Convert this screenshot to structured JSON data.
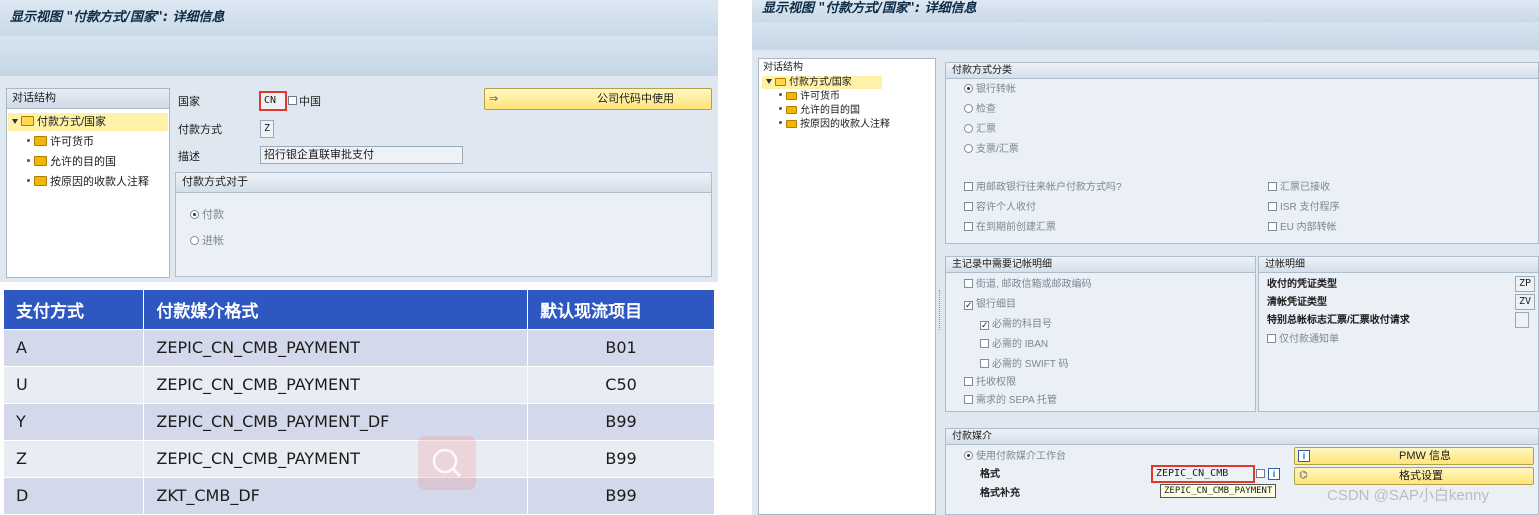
{
  "left": {
    "window_title": "显示视图 \"付款方式/国家\": 详细信息",
    "dialog_structure": {
      "header": "对话结构",
      "items": [
        {
          "label": "付款方式/国家",
          "selected": true,
          "expanded": true
        },
        {
          "label": "许可货币"
        },
        {
          "label": "允许的目的国"
        },
        {
          "label": "按原因的收款人注释"
        }
      ]
    },
    "form": {
      "country_label": "国家",
      "country_value": "CN",
      "country_name": "中国",
      "payment_method_label": "付款方式",
      "payment_method_value": "Z",
      "description_label": "描述",
      "description_value": "招行银企直联审批支付",
      "company_code_button": "公司代码中使用"
    },
    "payment_method_for": {
      "header": "付款方式对于",
      "options": [
        {
          "label": "付款",
          "checked": true
        },
        {
          "label": "进帐",
          "checked": false
        }
      ]
    }
  },
  "table": {
    "headers": [
      "支付方式",
      "付款媒介格式",
      "默认现流项目"
    ],
    "rows": [
      [
        "A",
        "ZEPIC_CN_CMB_PAYMENT",
        "B01"
      ],
      [
        "U",
        "ZEPIC_CN_CMB_PAYMENT",
        "C50"
      ],
      [
        "Y",
        "ZEPIC_CN_CMB_PAYMENT_DF",
        "B99"
      ],
      [
        "Z",
        "ZEPIC_CN_CMB_PAYMENT",
        "B99"
      ],
      [
        "D",
        "ZKT_CMB_DF",
        "B99"
      ]
    ],
    "header_color": "#2e57c2",
    "row_colors": [
      "#d3d8ea",
      "#eaecf4"
    ]
  },
  "right": {
    "window_title": "显示视图 \"付款方式/国家\": 详细信息",
    "dialog_structure": {
      "header": "对话结构",
      "items": [
        {
          "label": "付款方式/国家",
          "selected": true,
          "expanded": true
        },
        {
          "label": "许可货币"
        },
        {
          "label": "允许的目的国"
        },
        {
          "label": "按原因的收款人注释"
        }
      ]
    },
    "classification": {
      "header": "付款方式分类",
      "radios": [
        {
          "label": "银行转帐",
          "checked": true
        },
        {
          "label": "检查",
          "checked": false
        },
        {
          "label": "汇票",
          "checked": false
        },
        {
          "label": "支票/汇票",
          "checked": false
        }
      ],
      "checks_left": [
        {
          "label": "用邮政银行往来帐户付款方式吗?",
          "checked": false
        },
        {
          "label": "容许个人收付",
          "checked": false
        },
        {
          "label": "在到期前创建汇票",
          "checked": false
        }
      ],
      "checks_right": [
        {
          "label": "汇票已接收",
          "checked": false
        },
        {
          "label": "ISR 支付程序",
          "checked": false
        },
        {
          "label": "EU 内部转帐",
          "checked": false
        }
      ]
    },
    "master_record": {
      "header": "主记录中需要记帐明细",
      "checks": [
        {
          "label": "街道, 邮政信箱或邮政编码",
          "checked": false
        },
        {
          "label": "银行细目",
          "checked": true
        },
        {
          "label": "必需的科目号",
          "checked": true
        },
        {
          "label": "必需的 IBAN",
          "checked": false
        },
        {
          "label": "必需的 SWIFT 码",
          "checked": false
        },
        {
          "label": "托收权限",
          "checked": false
        },
        {
          "label": "需求的 SEPA 托管",
          "checked": false
        }
      ]
    },
    "posting": {
      "header": "过帐明细",
      "doc_type_label": "收付的凭证类型",
      "doc_type_value": "ZP",
      "clearing_type_label": "清帐凭证类型",
      "clearing_type_value": "ZV",
      "special_gl_label": "特别总帐标志汇票/汇票收付请求",
      "special_gl_value": "",
      "payment_advice_only": "仅付款通知单"
    },
    "payment_medium": {
      "header": "付款媒介",
      "use_workbench": "使用付款媒介工作台",
      "format_label": "格式",
      "format_value": "ZEPIC_CN_CMB",
      "format_supplement_label": "格式补充",
      "pmw_info_button": "PMW 信息",
      "format_settings_button": "格式设置",
      "tooltip": "ZEPIC_CN_CMB_PAYMENT"
    }
  },
  "watermark": "CSDN @SAP小白kenny"
}
